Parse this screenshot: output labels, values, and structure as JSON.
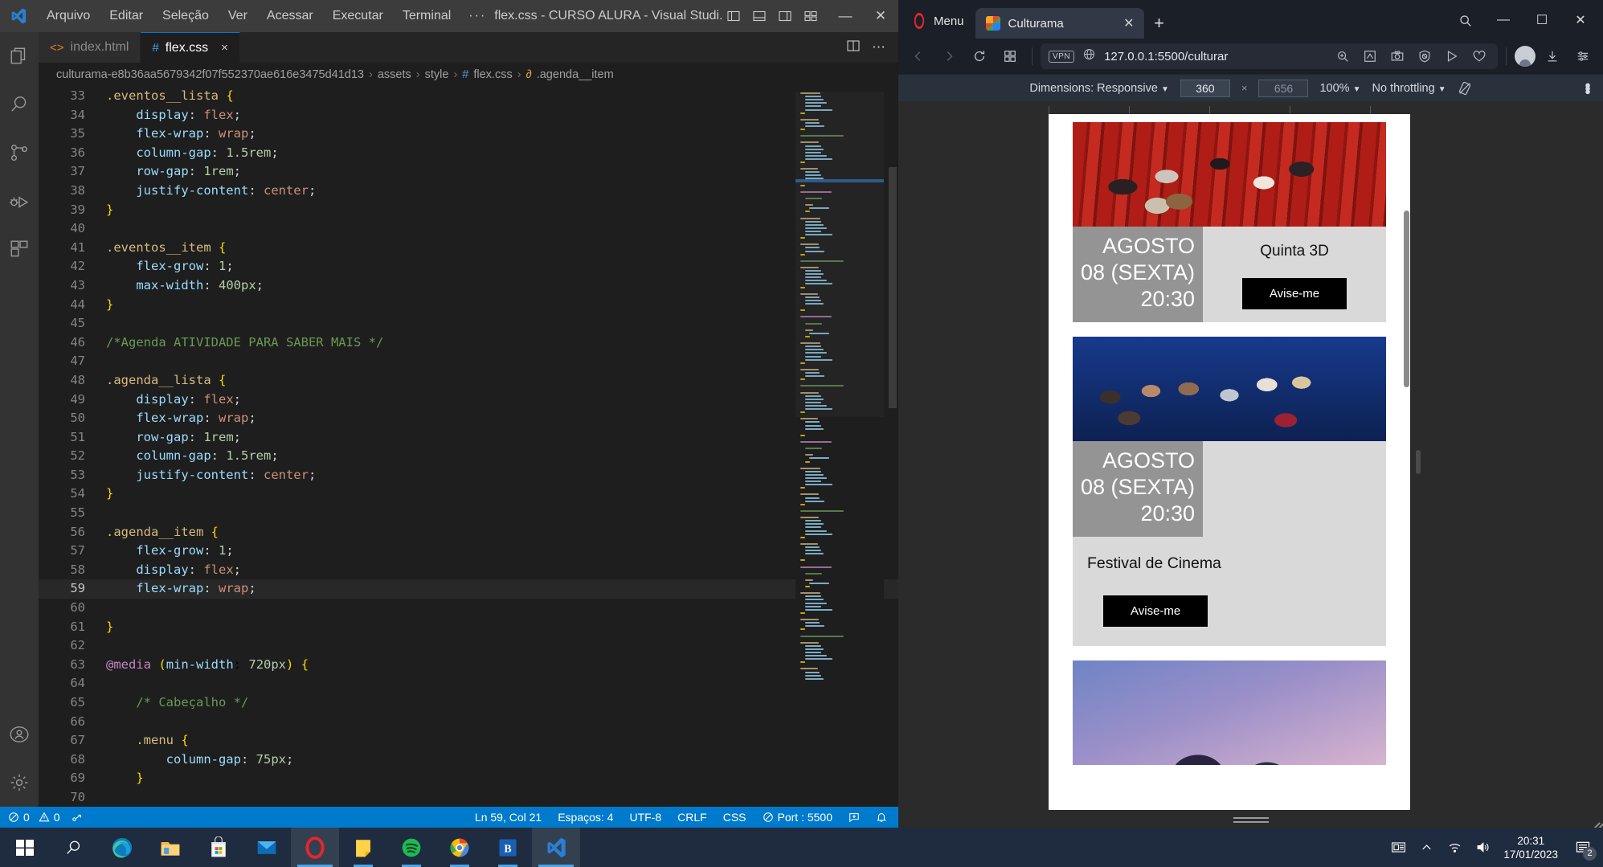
{
  "vscode": {
    "window_title": "flex.css - CURSO ALURA - Visual Studi...",
    "menu": [
      "Arquivo",
      "Editar",
      "Seleção",
      "Ver",
      "Acessar",
      "Executar",
      "Terminal"
    ],
    "menu_overflow": "···",
    "tabs": [
      {
        "label": "index.html",
        "icon": "html-icon",
        "active": false
      },
      {
        "label": "flex.css",
        "icon": "css-icon",
        "active": true,
        "close": "×"
      }
    ],
    "breadcrumb": [
      "culturama-e8b36aa5679342f07f552370ae616e3475d41d13",
      "assets",
      "style",
      "flex.css",
      ".agenda__item"
    ],
    "breadcrumb_sep": "›",
    "code_lines": [
      {
        "n": 33,
        "text": ".eventos__lista {",
        "type": "sel"
      },
      {
        "n": 34,
        "text": "    display: flex;",
        "type": "decl"
      },
      {
        "n": 35,
        "text": "    flex-wrap: wrap;",
        "type": "decl"
      },
      {
        "n": 36,
        "text": "    column-gap: 1.5rem;",
        "type": "decl-num"
      },
      {
        "n": 37,
        "text": "    row-gap: 1rem;",
        "type": "decl-num"
      },
      {
        "n": 38,
        "text": "    justify-content: center;",
        "type": "decl"
      },
      {
        "n": 39,
        "text": "}",
        "type": "brace"
      },
      {
        "n": 40,
        "text": "",
        "type": "blank"
      },
      {
        "n": 41,
        "text": ".eventos__item {",
        "type": "sel"
      },
      {
        "n": 42,
        "text": "    flex-grow: 1;",
        "type": "decl-num"
      },
      {
        "n": 43,
        "text": "    max-width: 400px;",
        "type": "decl-num"
      },
      {
        "n": 44,
        "text": "}",
        "type": "brace"
      },
      {
        "n": 45,
        "text": "",
        "type": "blank"
      },
      {
        "n": 46,
        "text": "/*Agenda ATIVIDADE PARA SABER MAIS */",
        "type": "comment"
      },
      {
        "n": 47,
        "text": "",
        "type": "blank"
      },
      {
        "n": 48,
        "text": ".agenda__lista {",
        "type": "sel"
      },
      {
        "n": 49,
        "text": "    display: flex;",
        "type": "decl"
      },
      {
        "n": 50,
        "text": "    flex-wrap: wrap;",
        "type": "decl"
      },
      {
        "n": 51,
        "text": "    row-gap: 1rem;",
        "type": "decl-num"
      },
      {
        "n": 52,
        "text": "    column-gap: 1.5rem;",
        "type": "decl-num"
      },
      {
        "n": 53,
        "text": "    justify-content: center;",
        "type": "decl"
      },
      {
        "n": 54,
        "text": "}",
        "type": "brace"
      },
      {
        "n": 55,
        "text": "",
        "type": "blank"
      },
      {
        "n": 56,
        "text": ".agenda__item {",
        "type": "sel"
      },
      {
        "n": 57,
        "text": "    flex-grow: 1;",
        "type": "decl-num"
      },
      {
        "n": 58,
        "text": "    display: flex;",
        "type": "decl"
      },
      {
        "n": 59,
        "text": "    flex-wrap: wrap;",
        "type": "decl",
        "current": true
      },
      {
        "n": 60,
        "text": "",
        "type": "blank"
      },
      {
        "n": 61,
        "text": "}",
        "type": "brace"
      },
      {
        "n": 62,
        "text": "",
        "type": "blank"
      },
      {
        "n": 63,
        "text": "@media (min-width: 720px) {",
        "type": "media"
      },
      {
        "n": 64,
        "text": "",
        "type": "blank"
      },
      {
        "n": 65,
        "text": "    /* Cabeçalho */",
        "type": "comment"
      },
      {
        "n": 66,
        "text": "",
        "type": "blank"
      },
      {
        "n": 67,
        "text": "    .menu {",
        "type": "sel"
      },
      {
        "n": 68,
        "text": "        column-gap: 75px;",
        "type": "decl-num"
      },
      {
        "n": 69,
        "text": "    }",
        "type": "brace"
      },
      {
        "n": 70,
        "text": "",
        "type": "blank"
      }
    ],
    "status": {
      "errors": "0",
      "warnings": "0",
      "cursor": "Ln 59, Col 21",
      "indent": "Espaços: 4",
      "encoding": "UTF-8",
      "eol": "CRLF",
      "language": "CSS",
      "port": "Port : 5500"
    }
  },
  "opera": {
    "menu_label": "Menu",
    "tab_title": "Culturama",
    "tab_close": "✕",
    "new_tab": "+",
    "url": "127.0.0.1:5500/culturar",
    "vpn_label": "VPN",
    "window_buttons": {
      "minimize": "—",
      "maximize": "☐",
      "close": "✕"
    }
  },
  "devtools": {
    "dimensions_label": "Dimensions: Responsive",
    "width": "360",
    "height": "656",
    "multiply": "×",
    "zoom": "100%",
    "throttling": "No throttling",
    "caret": "▼",
    "kebab": "⋮"
  },
  "page": {
    "cards": [
      {
        "image": "cinema-3d-audience-red-seats",
        "month": "AGOSTO",
        "day": "08 (SEXTA)",
        "time": "20:30",
        "title": "Quinta 3D",
        "button": "Avise-me",
        "layout": "inline"
      },
      {
        "image": "cinema-audience-blue-stage",
        "month": "AGOSTO",
        "day": "08 (SEXTA)",
        "time": "20:30",
        "title": "Festival de Cinema",
        "button": "Avise-me",
        "layout": "stacked"
      },
      {
        "image": "hot-air-balloons-sunset",
        "month": "",
        "day": "",
        "time": "",
        "title": "",
        "button": "",
        "layout": "partial"
      }
    ]
  },
  "taskbar": {
    "apps": [
      {
        "name": "start-button",
        "label": "Windows"
      },
      {
        "name": "search",
        "label": "Pesquisar"
      },
      {
        "name": "edge",
        "label": "Microsoft Edge"
      },
      {
        "name": "file-explorer",
        "label": "Explorador de Arquivos"
      },
      {
        "name": "microsoft-store",
        "label": "Microsoft Store"
      },
      {
        "name": "mail",
        "label": "Email"
      },
      {
        "name": "opera",
        "label": "Opera"
      },
      {
        "name": "sticky-notes",
        "label": "Notas"
      },
      {
        "name": "spotify",
        "label": "Spotify"
      },
      {
        "name": "chrome",
        "label": "Google Chrome"
      },
      {
        "name": "figma-like",
        "label": "App"
      },
      {
        "name": "vscode",
        "label": "Visual Studio Code"
      }
    ],
    "tray": {
      "time": "20:31",
      "date": "17/01/2023",
      "notification_count": "2"
    }
  }
}
